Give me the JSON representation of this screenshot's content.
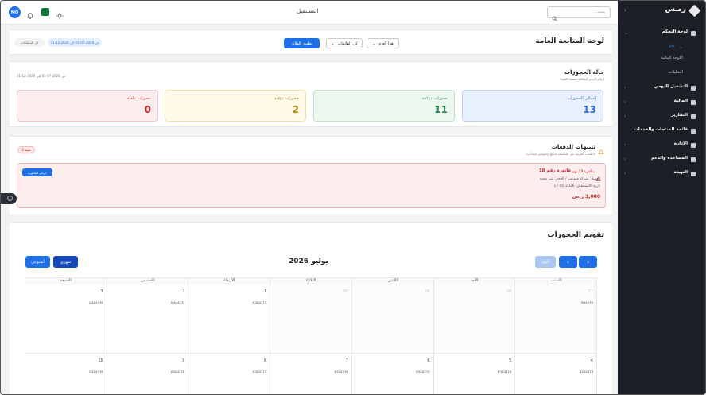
{
  "topbar": {
    "title": "المستقبل",
    "search_placeholder": "بحث...",
    "avatar": "MO"
  },
  "header": {
    "page_title": "لوحة المتابعة العامة",
    "period_select": "هذا العام",
    "list_select": "كل القائمات",
    "apply_button": "تطبيق الفلاتر",
    "date_range": "من 2026-07-01 إلى 2026-12-31",
    "all_properties": "كل الممتلكات"
  },
  "bookings_status": {
    "title": "حالة الحجوزات",
    "subtitle": "أرقام الحجز الفعالية حسب الفترة",
    "range": "من 2026-07-01 إلى 2026-12-31",
    "stats": [
      {
        "label": "إجمالي الحجوزات",
        "value": "13"
      },
      {
        "label": "حجوزات مؤكدة",
        "value": "11"
      },
      {
        "label": "حجوزات مؤقتة",
        "value": "2"
      },
      {
        "label": "حجوزات ملغاة",
        "value": "0"
      }
    ]
  },
  "payment_alerts": {
    "title": "تنبيهات الدفعات",
    "subtitle": "الدفعات القريبة غير المكتملة الدفع والفواتير المتأخرة",
    "badge": "1 تنبيه",
    "alert": {
      "status": "متأخرة 12 يوم",
      "invoice": "فاتورة رقم 18",
      "client": "العميل: شركة فيوتشر / الحجز: غير محدد",
      "due": "تاريخ الاستحقاق: 2026-05-17",
      "amount": "3,000 ر.س",
      "view_button": "عرض الفاتورة"
    }
  },
  "calendar": {
    "title": "تقويم الحجوزات",
    "month_title": "يوليو 2026",
    "today_button": "اليوم",
    "monthly_button": "شهري",
    "weekly_button": "أسبوعي",
    "weekdays": [
      "السبت",
      "الأحد",
      "الاثنين",
      "الثلاثاء",
      "الأربعاء",
      "الخميس",
      "الجمعة"
    ],
    "week1": [
      {
        "day": "27",
        "muted": true,
        "event": "BA4376"
      },
      {
        "day": "28",
        "muted": true,
        "event": ""
      },
      {
        "day": "29",
        "muted": true,
        "event": ""
      },
      {
        "day": "30",
        "muted": true,
        "event": ""
      },
      {
        "day": "1",
        "muted": false,
        "event": "B3A4373"
      },
      {
        "day": "2",
        "muted": false,
        "event": "B3A4375"
      },
      {
        "day": "3",
        "muted": false,
        "event": "B3A4376"
      }
    ],
    "week2": [
      {
        "day": "4",
        "muted": false,
        "event": "B3A4376"
      },
      {
        "day": "5",
        "muted": false,
        "event": "B3A4376"
      },
      {
        "day": "6",
        "muted": false,
        "event": "B3A4373"
      },
      {
        "day": "7",
        "muted": false,
        "event": "B3A4376"
      },
      {
        "day": "8",
        "muted": false,
        "event": "B3A4373"
      },
      {
        "day": "9",
        "muted": false,
        "event": "B3A4376"
      },
      {
        "day": "10",
        "muted": false,
        "event": "B3A4376"
      }
    ]
  },
  "sidebar": {
    "brand": "رمـس",
    "items": [
      {
        "label": "لوحة التحكم",
        "icon": "grid-icon"
      },
      {
        "label": "عام",
        "icon": ""
      },
      {
        "label": "اللوحة المالية",
        "icon": ""
      },
      {
        "label": "التحليلات",
        "icon": ""
      },
      {
        "label": "التشغيل اليومي",
        "icon": "list-icon"
      },
      {
        "label": "المالية",
        "icon": "wallet-icon"
      },
      {
        "label": "التقارير",
        "icon": "report-icon"
      },
      {
        "label": "قائمة المنتجات والخدمات",
        "icon": "grid-icon"
      },
      {
        "label": "الإدارة",
        "icon": "shield-icon"
      },
      {
        "label": "المساعدة والدعم",
        "icon": "help-icon"
      },
      {
        "label": "التهيئة",
        "icon": "gear-icon"
      }
    ]
  },
  "colors": {
    "accent": "#1e6fe8",
    "sidebar_bg": "#1c1f26",
    "danger": "#d32f2f"
  }
}
